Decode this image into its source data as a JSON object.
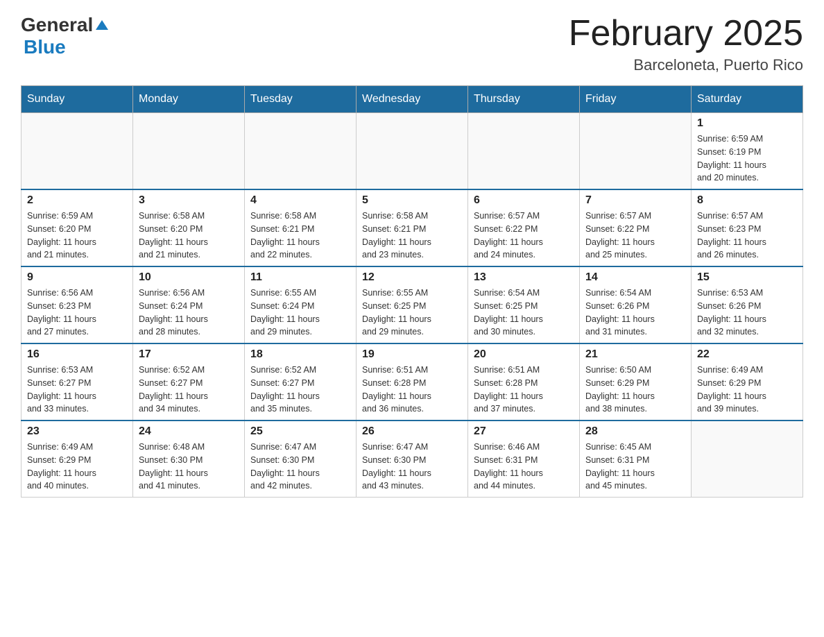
{
  "header": {
    "logo_general": "General",
    "logo_blue": "Blue",
    "month_title": "February 2025",
    "location": "Barceloneta, Puerto Rico"
  },
  "days_of_week": [
    "Sunday",
    "Monday",
    "Tuesday",
    "Wednesday",
    "Thursday",
    "Friday",
    "Saturday"
  ],
  "weeks": [
    [
      {
        "day": "",
        "info": ""
      },
      {
        "day": "",
        "info": ""
      },
      {
        "day": "",
        "info": ""
      },
      {
        "day": "",
        "info": ""
      },
      {
        "day": "",
        "info": ""
      },
      {
        "day": "",
        "info": ""
      },
      {
        "day": "1",
        "info": "Sunrise: 6:59 AM\nSunset: 6:19 PM\nDaylight: 11 hours\nand 20 minutes."
      }
    ],
    [
      {
        "day": "2",
        "info": "Sunrise: 6:59 AM\nSunset: 6:20 PM\nDaylight: 11 hours\nand 21 minutes."
      },
      {
        "day": "3",
        "info": "Sunrise: 6:58 AM\nSunset: 6:20 PM\nDaylight: 11 hours\nand 21 minutes."
      },
      {
        "day": "4",
        "info": "Sunrise: 6:58 AM\nSunset: 6:21 PM\nDaylight: 11 hours\nand 22 minutes."
      },
      {
        "day": "5",
        "info": "Sunrise: 6:58 AM\nSunset: 6:21 PM\nDaylight: 11 hours\nand 23 minutes."
      },
      {
        "day": "6",
        "info": "Sunrise: 6:57 AM\nSunset: 6:22 PM\nDaylight: 11 hours\nand 24 minutes."
      },
      {
        "day": "7",
        "info": "Sunrise: 6:57 AM\nSunset: 6:22 PM\nDaylight: 11 hours\nand 25 minutes."
      },
      {
        "day": "8",
        "info": "Sunrise: 6:57 AM\nSunset: 6:23 PM\nDaylight: 11 hours\nand 26 minutes."
      }
    ],
    [
      {
        "day": "9",
        "info": "Sunrise: 6:56 AM\nSunset: 6:23 PM\nDaylight: 11 hours\nand 27 minutes."
      },
      {
        "day": "10",
        "info": "Sunrise: 6:56 AM\nSunset: 6:24 PM\nDaylight: 11 hours\nand 28 minutes."
      },
      {
        "day": "11",
        "info": "Sunrise: 6:55 AM\nSunset: 6:24 PM\nDaylight: 11 hours\nand 29 minutes."
      },
      {
        "day": "12",
        "info": "Sunrise: 6:55 AM\nSunset: 6:25 PM\nDaylight: 11 hours\nand 29 minutes."
      },
      {
        "day": "13",
        "info": "Sunrise: 6:54 AM\nSunset: 6:25 PM\nDaylight: 11 hours\nand 30 minutes."
      },
      {
        "day": "14",
        "info": "Sunrise: 6:54 AM\nSunset: 6:26 PM\nDaylight: 11 hours\nand 31 minutes."
      },
      {
        "day": "15",
        "info": "Sunrise: 6:53 AM\nSunset: 6:26 PM\nDaylight: 11 hours\nand 32 minutes."
      }
    ],
    [
      {
        "day": "16",
        "info": "Sunrise: 6:53 AM\nSunset: 6:27 PM\nDaylight: 11 hours\nand 33 minutes."
      },
      {
        "day": "17",
        "info": "Sunrise: 6:52 AM\nSunset: 6:27 PM\nDaylight: 11 hours\nand 34 minutes."
      },
      {
        "day": "18",
        "info": "Sunrise: 6:52 AM\nSunset: 6:27 PM\nDaylight: 11 hours\nand 35 minutes."
      },
      {
        "day": "19",
        "info": "Sunrise: 6:51 AM\nSunset: 6:28 PM\nDaylight: 11 hours\nand 36 minutes."
      },
      {
        "day": "20",
        "info": "Sunrise: 6:51 AM\nSunset: 6:28 PM\nDaylight: 11 hours\nand 37 minutes."
      },
      {
        "day": "21",
        "info": "Sunrise: 6:50 AM\nSunset: 6:29 PM\nDaylight: 11 hours\nand 38 minutes."
      },
      {
        "day": "22",
        "info": "Sunrise: 6:49 AM\nSunset: 6:29 PM\nDaylight: 11 hours\nand 39 minutes."
      }
    ],
    [
      {
        "day": "23",
        "info": "Sunrise: 6:49 AM\nSunset: 6:29 PM\nDaylight: 11 hours\nand 40 minutes."
      },
      {
        "day": "24",
        "info": "Sunrise: 6:48 AM\nSunset: 6:30 PM\nDaylight: 11 hours\nand 41 minutes."
      },
      {
        "day": "25",
        "info": "Sunrise: 6:47 AM\nSunset: 6:30 PM\nDaylight: 11 hours\nand 42 minutes."
      },
      {
        "day": "26",
        "info": "Sunrise: 6:47 AM\nSunset: 6:30 PM\nDaylight: 11 hours\nand 43 minutes."
      },
      {
        "day": "27",
        "info": "Sunrise: 6:46 AM\nSunset: 6:31 PM\nDaylight: 11 hours\nand 44 minutes."
      },
      {
        "day": "28",
        "info": "Sunrise: 6:45 AM\nSunset: 6:31 PM\nDaylight: 11 hours\nand 45 minutes."
      },
      {
        "day": "",
        "info": ""
      }
    ]
  ]
}
